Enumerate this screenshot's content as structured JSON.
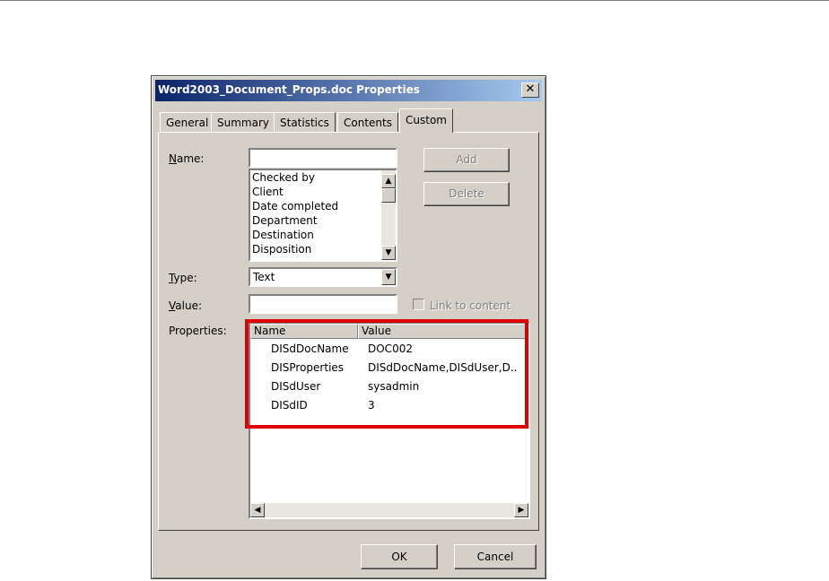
{
  "dialog": {
    "title": "Word2003_Document_Props.doc Properties",
    "close_glyph": "✕"
  },
  "tabs": [
    {
      "label": "General",
      "active": false
    },
    {
      "label": "Summary",
      "active": false
    },
    {
      "label": "Statistics",
      "active": false
    },
    {
      "label": "Contents",
      "active": false
    },
    {
      "label": "Custom",
      "active": true
    }
  ],
  "form": {
    "name_label": "Name:",
    "name_value": "",
    "name_list": [
      "Checked by",
      "Client",
      "Date completed",
      "Department",
      "Destination",
      "Disposition"
    ],
    "add_label": "Add",
    "delete_label": "Delete",
    "type_label": "Type:",
    "type_value": "Text",
    "value_label": "Value:",
    "value_value": "",
    "link_to_content_label": "Link to content",
    "link_to_content_checked": false,
    "properties_label": "Properties:"
  },
  "properties": {
    "columns": [
      "Name",
      "Value"
    ],
    "rows": [
      {
        "name": "DISdDocName",
        "value": "DOC002"
      },
      {
        "name": "DISProperties",
        "value": "DISdDocName,DISdUser,D.."
      },
      {
        "name": "DISdUser",
        "value": "sysadmin"
      },
      {
        "name": "DISdID",
        "value": "3"
      }
    ]
  },
  "footer": {
    "ok_label": "OK",
    "cancel_label": "Cancel"
  },
  "colors": {
    "title_gradient_start": "#0a246a",
    "title_gradient_end": "#a6caf0",
    "dialog_face": "#d4d0c8",
    "highlight": "#e00000"
  }
}
